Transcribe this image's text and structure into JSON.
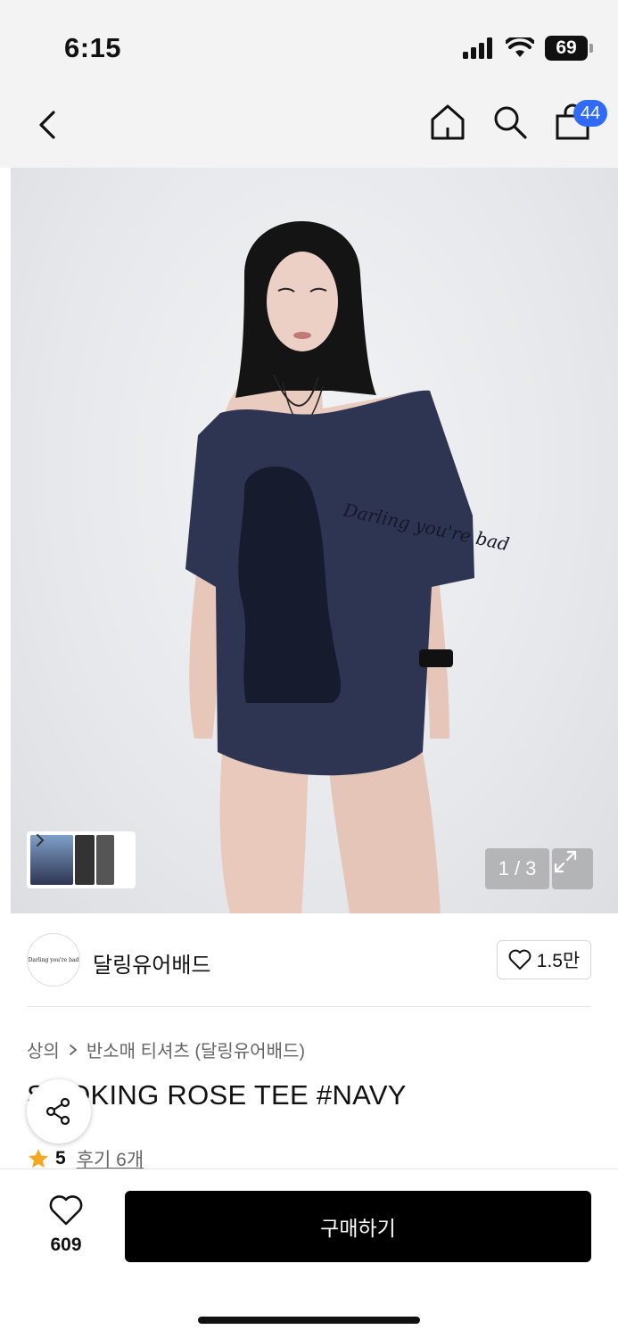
{
  "status_bar": {
    "time": "6:15",
    "battery": "69"
  },
  "nav": {
    "cart_count": "44"
  },
  "hero": {
    "counter": "1 / 3",
    "print_text": "Darling you're bad"
  },
  "brand": {
    "logo_text": "Darling you're bad",
    "name": "달링유어배드",
    "likes": "1.5만"
  },
  "breadcrumb": {
    "category": "상의",
    "subcategory": "반소매 티셔츠 (달링유어배드)"
  },
  "product": {
    "title": "SMOKING ROSE TEE #NAVY"
  },
  "rating": {
    "score": "5",
    "reviews": "후기 6개"
  },
  "bottom_bar": {
    "wish_count": "609",
    "buy_label": "구매하기"
  },
  "colors": {
    "accent": "#2f6bf6",
    "tee": "#2e3553",
    "star": "#f5a623"
  },
  "icons": [
    "back-icon",
    "home-icon",
    "search-icon",
    "bag-icon",
    "chevron-right-icon",
    "expand-icon",
    "heart-icon",
    "share-icon",
    "star-icon"
  ]
}
